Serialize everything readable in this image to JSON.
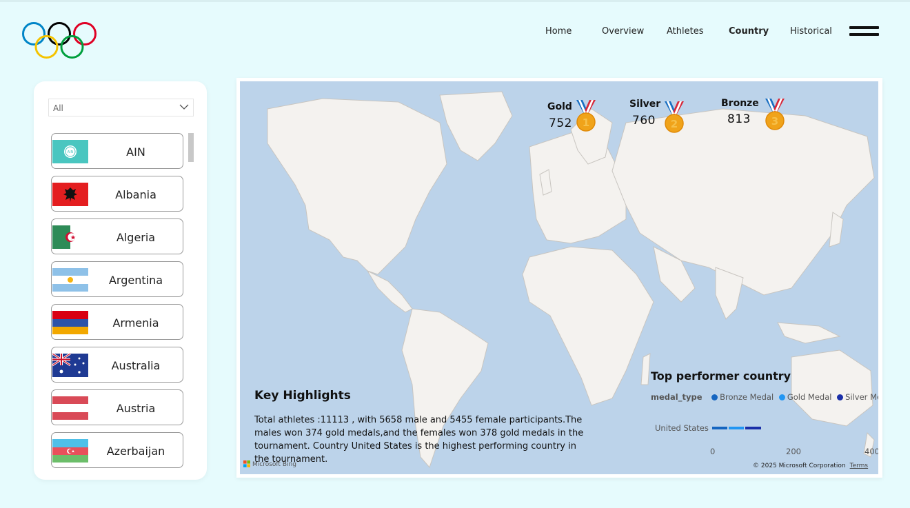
{
  "nav": {
    "items": [
      {
        "label": "Home",
        "active": false
      },
      {
        "label": "Overview",
        "active": false
      },
      {
        "label": "Athletes",
        "active": false
      },
      {
        "label": "Country",
        "active": true
      },
      {
        "label": "Historical",
        "active": false
      }
    ],
    "menu_icon": "hamburger-icon"
  },
  "logo": {
    "icon": "olympic-rings-logo",
    "colors": [
      "#0085c7",
      "#000000",
      "#df0024",
      "#f4c300",
      "#009f3d"
    ]
  },
  "filter": {
    "selected": "All",
    "icon": "chevron-down-icon"
  },
  "countries": [
    {
      "name": "AIN",
      "flag": "ain-flag"
    },
    {
      "name": "Albania",
      "flag": "albania-flag"
    },
    {
      "name": "Algeria",
      "flag": "algeria-flag"
    },
    {
      "name": "Argentina",
      "flag": "argentina-flag"
    },
    {
      "name": "Armenia",
      "flag": "armenia-flag"
    },
    {
      "name": "Australia",
      "flag": "australia-flag"
    },
    {
      "name": "Austria",
      "flag": "austria-flag"
    },
    {
      "name": "Azerbaijan",
      "flag": "azerbaijan-flag"
    }
  ],
  "medals": {
    "gold": {
      "label": "Gold",
      "count": "752",
      "rank": "1"
    },
    "silver": {
      "label": "Silver",
      "count": "760",
      "rank": "2"
    },
    "bronze": {
      "label": "Bronze",
      "count": "813",
      "rank": "3"
    }
  },
  "highlights": {
    "title": "Key Highlights",
    "text": "Total athletes :11113 , with 5658 male and 5455 female participants.The males won 374 gold medals,and the females won 378 gold medals in the tournament. Country United States is the highest performing country in the tournament."
  },
  "top_performer": {
    "title": "Top performer country",
    "legend_label": "medal_type",
    "legend": [
      {
        "name": "Bronze Medal",
        "color": "#1565c0"
      },
      {
        "name": "Gold Medal",
        "color": "#2196f3"
      },
      {
        "name": "Silver Medal",
        "color": "#1a2fa8"
      }
    ],
    "category": "United States",
    "ticks": [
      "0",
      "200",
      "400"
    ]
  },
  "chart_data": {
    "type": "bar",
    "title": "Top performer country",
    "legend_title": "medal_type",
    "categories": [
      "United States"
    ],
    "series": [
      {
        "name": "Bronze Medal",
        "values": [
          42
        ]
      },
      {
        "name": "Gold Medal",
        "values": [
          40
        ]
      },
      {
        "name": "Silver Medal",
        "values": [
          44
        ]
      }
    ],
    "xlim": [
      0,
      400
    ],
    "stacked": true,
    "legend_position": "top"
  },
  "map": {
    "provider": "Microsoft Bing",
    "copyright": "© 2025 Microsoft Corporation",
    "terms": "Terms"
  }
}
